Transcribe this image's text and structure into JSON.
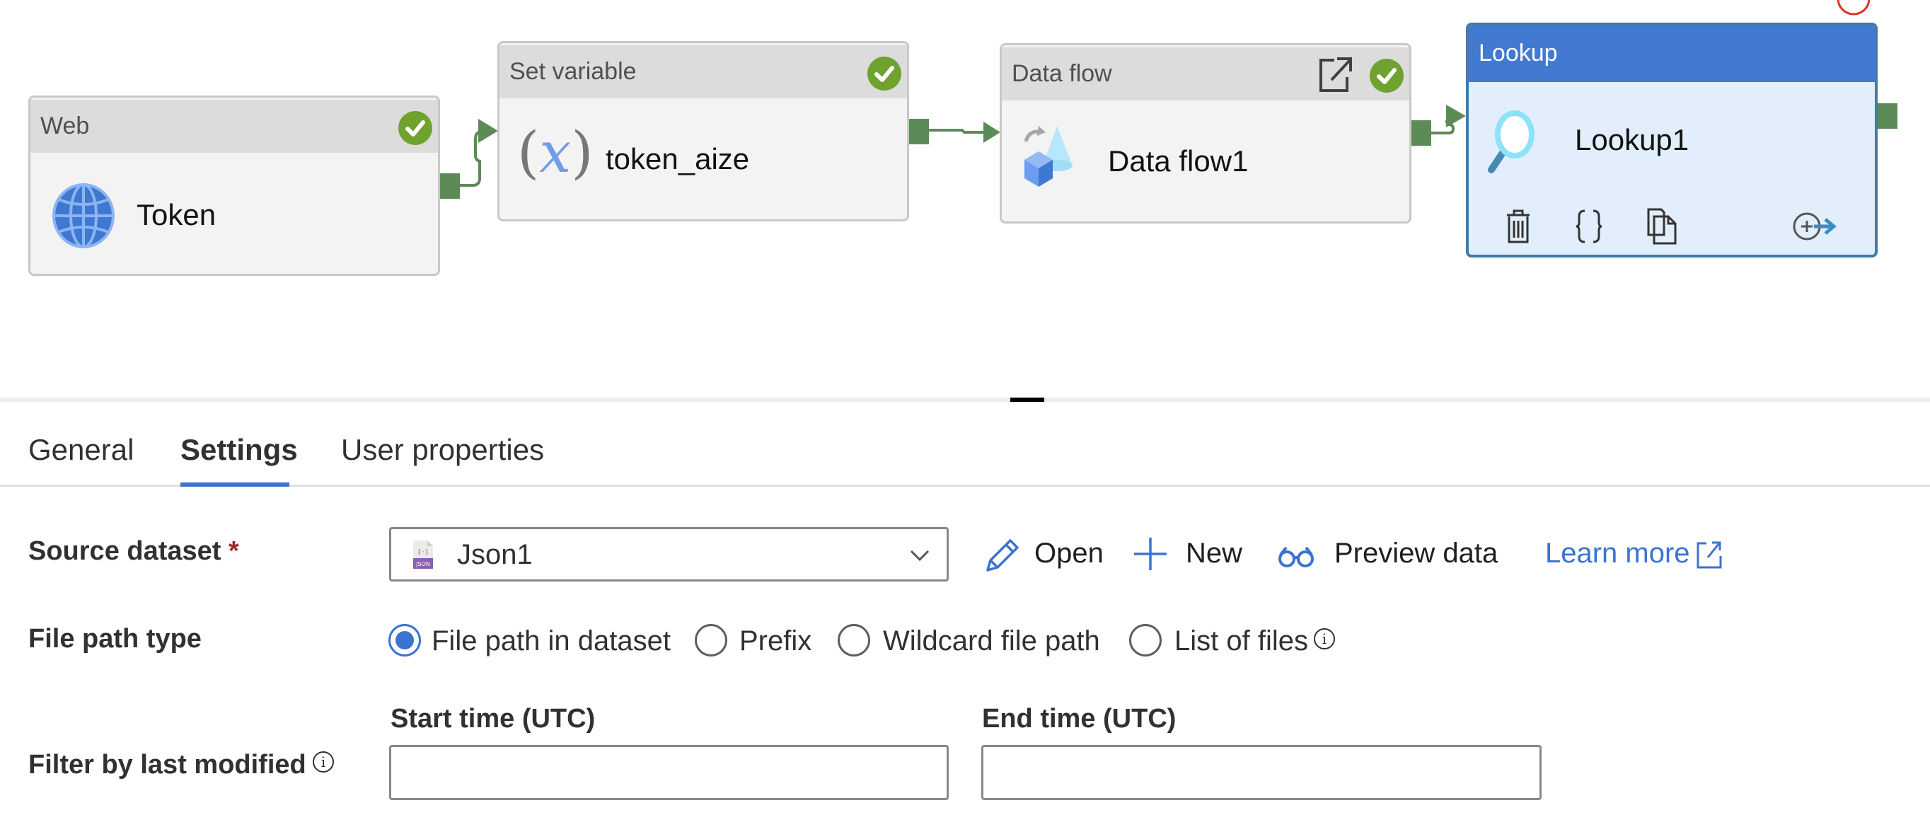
{
  "canvas": {
    "activities": [
      {
        "type": "Web",
        "name": "Token",
        "status": "succeeded",
        "icon": "globe-icon"
      },
      {
        "type": "Set variable",
        "name": "token_aize",
        "status": "succeeded",
        "icon": "variable-icon",
        "icon_glyph": "x"
      },
      {
        "type": "Data flow",
        "name": "Data flow1",
        "status": "succeeded",
        "icon": "data-flow-icon"
      },
      {
        "type": "Lookup",
        "name": "Lookup1",
        "status": "selected",
        "icon": "lookup-icon"
      }
    ],
    "colors": {
      "success": "#6fa22e",
      "connector": "#5d8b58",
      "selected_header": "#4279d1",
      "selected_body": "#e2eefb",
      "accent": "#3a73d0"
    }
  },
  "tabs": [
    {
      "label": "General",
      "active": false
    },
    {
      "label": "Settings",
      "active": true
    },
    {
      "label": "User properties",
      "active": false
    }
  ],
  "settings": {
    "source_dataset": {
      "label": "Source dataset",
      "required_mark": "*",
      "value": "Json1",
      "icon_text": "JSON"
    },
    "actions": {
      "open": "Open",
      "new": "New",
      "preview": "Preview data",
      "learn_more": "Learn more"
    },
    "file_path_type": {
      "label": "File path type",
      "options": [
        {
          "label": "File path in dataset",
          "selected": true
        },
        {
          "label": "Prefix",
          "selected": false
        },
        {
          "label": "Wildcard file path",
          "selected": false
        },
        {
          "label": "List of files",
          "selected": false
        }
      ],
      "info_glyph": "i"
    },
    "filter": {
      "label": "Filter by last modified",
      "info_glyph": "i",
      "start_label": "Start time (UTC)",
      "start_value": "",
      "end_label": "End time (UTC)",
      "end_value": ""
    }
  }
}
